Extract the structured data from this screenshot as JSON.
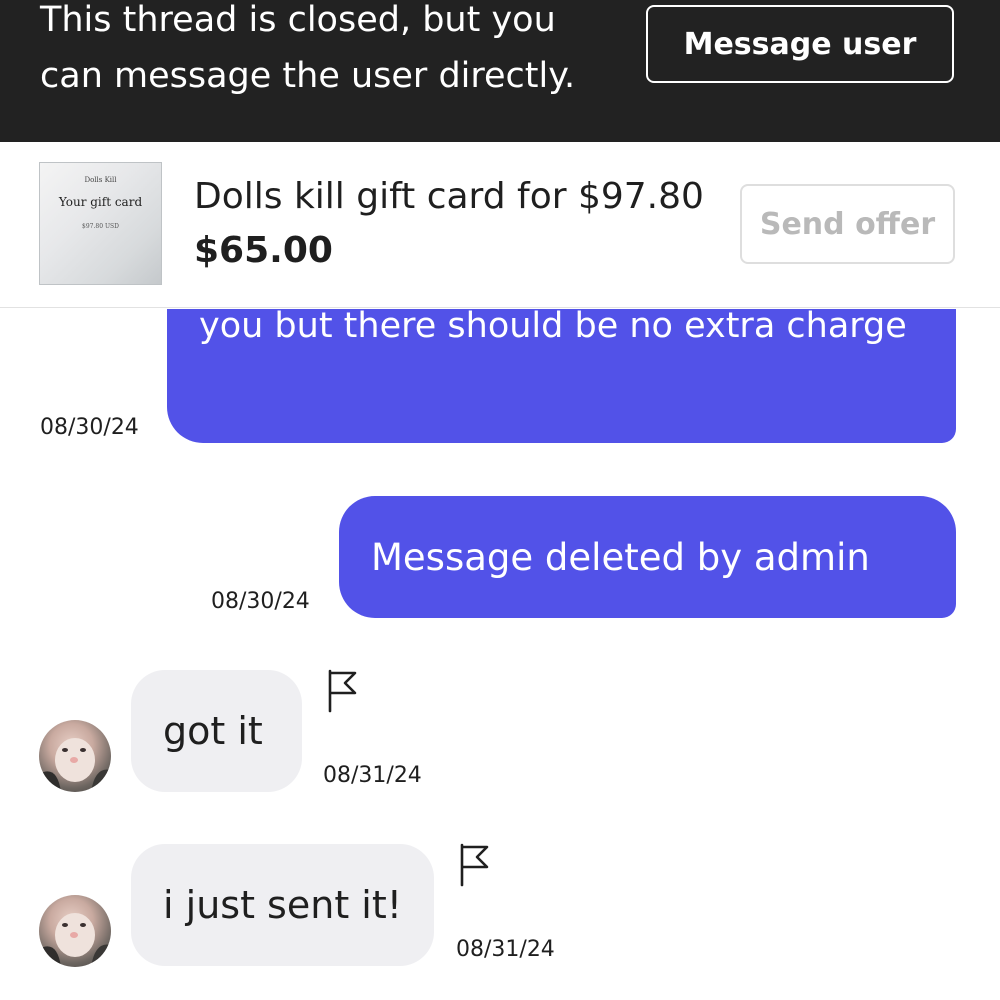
{
  "banner": {
    "text": "This thread is closed, but you can message the user directly.",
    "button_label": "Message user"
  },
  "listing": {
    "thumbnail": {
      "brand": "Dolls Kill",
      "title": "Your gift card",
      "amount": "$97.80 USD"
    },
    "title": "Dolls kill gift card for $97.80",
    "price": "$65.00",
    "send_offer_label": "Send offer"
  },
  "messages": [
    {
      "direction": "outgoing",
      "text": "you but there should be no extra charge",
      "date": "08/30/24"
    },
    {
      "direction": "outgoing",
      "text": "Message deleted by admin",
      "date": "08/30/24"
    },
    {
      "direction": "incoming",
      "text": "got it",
      "date": "08/31/24",
      "icon": "flag-icon"
    },
    {
      "direction": "incoming",
      "text": "i just sent it!",
      "date": "08/31/24",
      "icon": "flag-icon"
    }
  ],
  "colors": {
    "banner_bg": "#222222",
    "outgoing_bubble": "#5252e8",
    "incoming_bubble": "#efeff2"
  }
}
